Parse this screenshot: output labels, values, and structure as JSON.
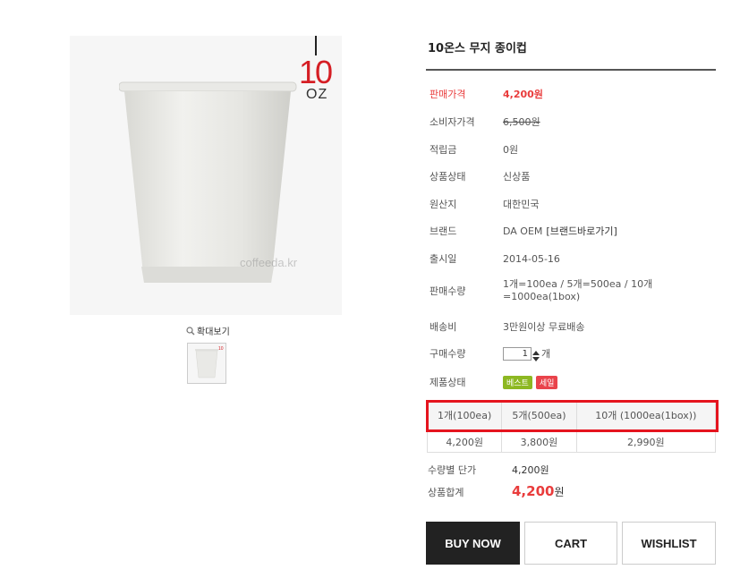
{
  "product": {
    "title": "10온스 무지 종이컵",
    "image_badge": {
      "number": "10",
      "unit": "OZ"
    },
    "watermark": "coffeeda.kr",
    "zoom_label": "확대보기"
  },
  "details": [
    {
      "key": "sale_price",
      "label": "판매가격",
      "value": "4,200원"
    },
    {
      "key": "consumer_price",
      "label": "소비자가격",
      "value": "6,500원"
    },
    {
      "key": "points",
      "label": "적립금",
      "value": "0원"
    },
    {
      "key": "condition",
      "label": "상품상태",
      "value": "신상품"
    },
    {
      "key": "origin",
      "label": "원산지",
      "value": "대한민국"
    },
    {
      "key": "brand",
      "label": "브랜드",
      "value": "DA OEM",
      "link": "[브랜드바로가기]"
    },
    {
      "key": "release",
      "label": "출시일",
      "value": "2014-05-16"
    },
    {
      "key": "sale_qty",
      "label": "판매수량",
      "value": "1개=100ea / 5개=500ea / 10개 =1000ea(1box)"
    },
    {
      "key": "shipping",
      "label": "배송비",
      "value": "3만원이상 무료배송"
    }
  ],
  "purchase_qty": {
    "label": "구매수량",
    "value": "1",
    "unit": "개"
  },
  "status": {
    "label": "제품상태",
    "badges": [
      "베스트",
      "세일"
    ]
  },
  "tiers": {
    "headers": [
      "1개(100ea)",
      "5개(500ea)",
      "10개 (1000ea(1box))"
    ],
    "prices": [
      "4,200원",
      "3,800원",
      "2,990원"
    ]
  },
  "unit_price": {
    "label": "수량별 단가",
    "value": "4,200원"
  },
  "total": {
    "label": "상품합계",
    "amount": "4,200",
    "unit": "원"
  },
  "buttons": {
    "buy": "BUY NOW",
    "cart": "CART",
    "wishlist": "WISHLIST"
  },
  "colors": {
    "accent": "#e93c3c",
    "highlight": "#e5141e",
    "buy_bg": "#222222",
    "best_badge": "#8db822",
    "sale_badge": "#e9434b"
  }
}
